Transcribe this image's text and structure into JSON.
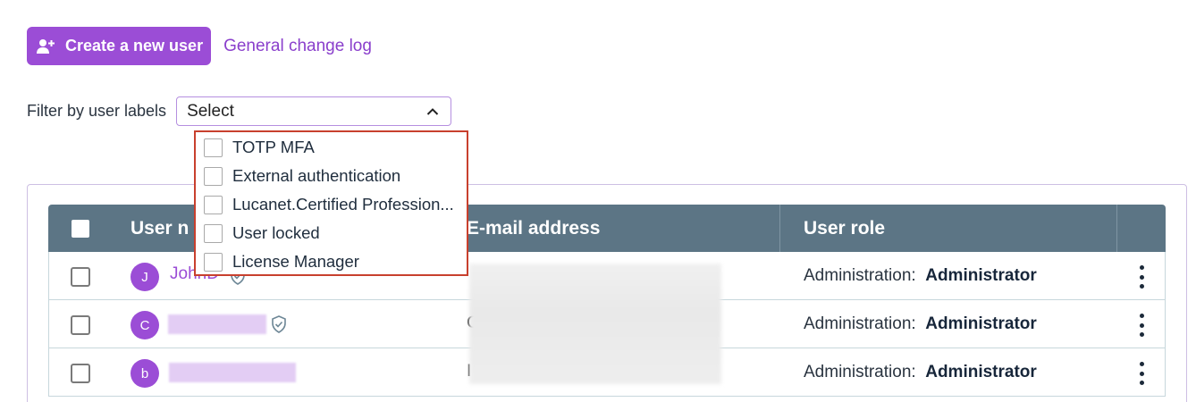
{
  "toolbar": {
    "create_label": "Create a new user",
    "create_icon": "add-user-icon",
    "change_log_label": "General change log"
  },
  "filter": {
    "label": "Filter by user labels",
    "select_value": "Select",
    "options": [
      "TOTP MFA",
      "External authentication",
      "Lucanet.Certified Profession...",
      "User locked",
      "License Manager"
    ]
  },
  "table": {
    "columns": [
      "User n",
      "E-mail address",
      "User role"
    ],
    "rows": [
      {
        "avatar": "J",
        "name": "JohnD",
        "email_start": "",
        "role_prefix": "Administration:",
        "role": "Administrator"
      },
      {
        "avatar": "C",
        "name": "",
        "email_start": "C",
        "role_prefix": "Administration:",
        "role": "Administrator"
      },
      {
        "avatar": "b",
        "name": "",
        "email_start": "I",
        "role_prefix": "Administration:",
        "role": "Administrator"
      }
    ]
  },
  "colors": {
    "accent": "#9b4dd6",
    "header_bg": "#5c7585",
    "highlight_border": "#c8402e"
  }
}
